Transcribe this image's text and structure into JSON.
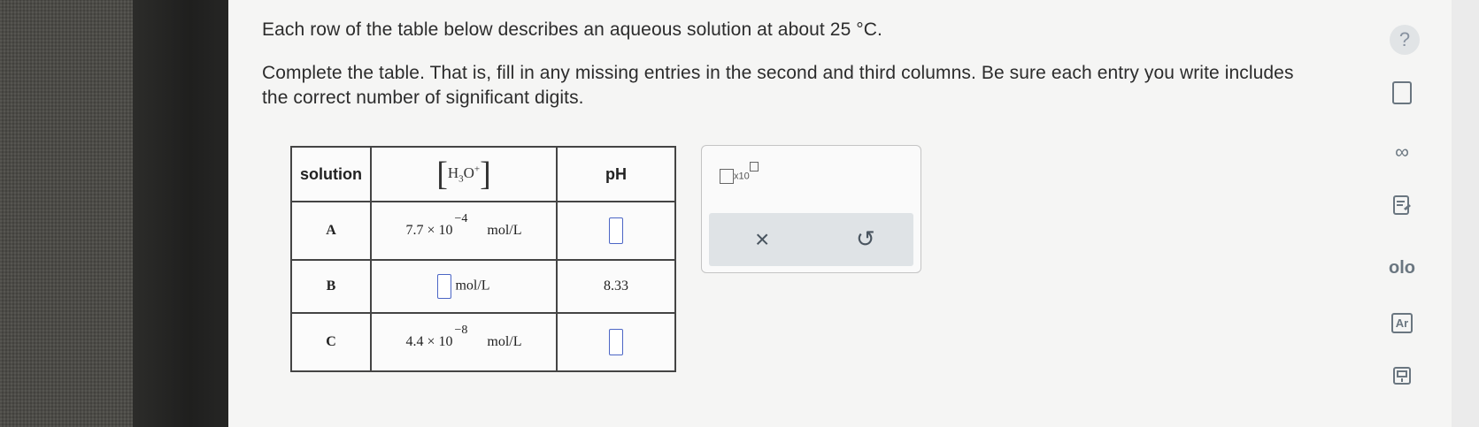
{
  "prompt": {
    "line1": "Each row of the table below describes an aqueous solution at about 25 °C.",
    "line2": "Complete the table. That is, fill in any missing entries in the second and third columns. Be sure each entry you write includes the correct number of significant digits."
  },
  "table": {
    "headers": {
      "solution": "solution",
      "h3o": "H3O+",
      "ph": "pH"
    },
    "rows": [
      {
        "solution": "A",
        "h3o_mantissa": "7.7",
        "h3o_base": "× 10",
        "h3o_exp": "−4",
        "h3o_unit": "mol/L",
        "ph": ""
      },
      {
        "solution": "B",
        "h3o_mantissa": "",
        "h3o_base": "",
        "h3o_exp": "",
        "h3o_unit": "mol/L",
        "ph": "8.33"
      },
      {
        "solution": "C",
        "h3o_mantissa": "4.4",
        "h3o_base": "× 10",
        "h3o_exp": "−8",
        "h3o_unit": "mol/L",
        "ph": ""
      }
    ]
  },
  "tool": {
    "x10": "x10",
    "clear": "×",
    "undo": "↺"
  },
  "sidebar": {
    "help": "?",
    "infinity": "∞",
    "chart": "olo",
    "periodic": "Ar"
  }
}
